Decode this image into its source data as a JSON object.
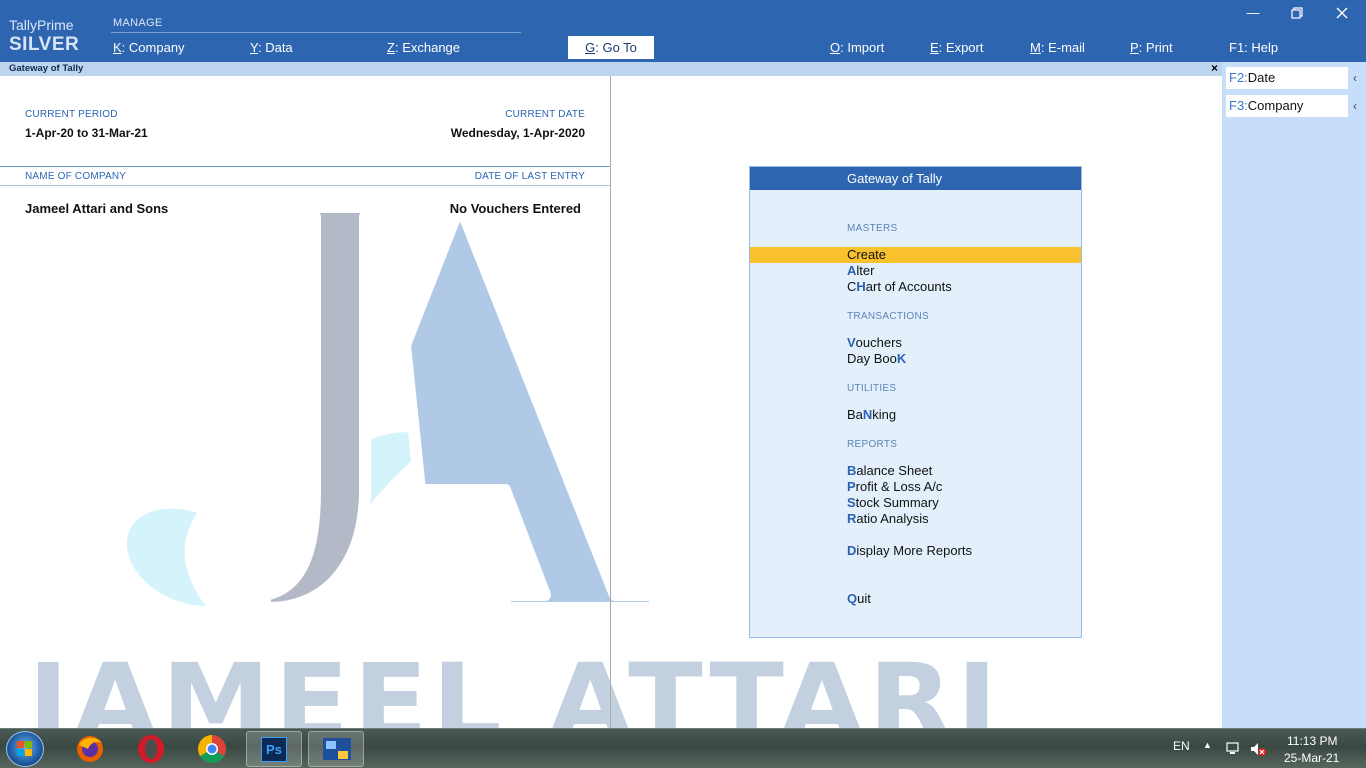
{
  "brand": {
    "product": "TallyPrime",
    "edition": "SILVER"
  },
  "menu": {
    "manage_label": "MANAGE",
    "company": {
      "key": "K",
      "label": "Company"
    },
    "data": {
      "key": "Y",
      "label": "Data"
    },
    "exchange": {
      "key": "Z",
      "label": "Exchange"
    },
    "goto": {
      "key": "G",
      "label": "Go To"
    },
    "import": {
      "key": "O",
      "label": "Import"
    },
    "export": {
      "key": "E",
      "label": "Export"
    },
    "email": {
      "key": "M",
      "label": "E-mail"
    },
    "print": {
      "key": "P",
      "label": "Print"
    },
    "help": {
      "key": "F1",
      "label": "Help"
    }
  },
  "subbar": {
    "title": "Gateway of Tally",
    "close": "×"
  },
  "right_panel": [
    {
      "key": "F2:",
      "label": "Date"
    },
    {
      "key": "F3:",
      "label": "Company"
    }
  ],
  "info": {
    "current_period_label": "CURRENT PERIOD",
    "current_period": "1-Apr-20 to 31-Mar-21",
    "current_date_label": "CURRENT DATE",
    "current_date": "Wednesday, 1-Apr-2020",
    "name_of_company_label": "NAME OF COMPANY",
    "date_of_last_entry_label": "DATE OF LAST ENTRY",
    "company_name": "Jameel Attari and Sons",
    "last_entry": "No Vouchers Entered"
  },
  "watermark": {
    "text": "JAMEEL ATTARI",
    "monogram": "JA"
  },
  "gateway": {
    "title": "Gateway of Tally",
    "sections": {
      "masters": "MASTERS",
      "transactions": "TRANSACTIONS",
      "utilities": "UTILITIES",
      "reports": "REPORTS"
    },
    "items": {
      "create": "Create",
      "alter": "Alter",
      "chart_of_accounts": "CHart of Accounts",
      "vouchers": "Vouchers",
      "day_book": "Day BooK",
      "banking": "BaNking",
      "balance_sheet": "Balance Sheet",
      "profit_loss": "Profit & Loss A/c",
      "stock_summary": "Stock Summary",
      "ratio_analysis": "Ratio Analysis",
      "display_more_reports": "Display More Reports",
      "quit": "Quit"
    }
  },
  "taskbar": {
    "lang": "EN",
    "time": "11:13 PM",
    "date": "25-Mar-21",
    "apps": [
      "firefox-icon",
      "opera-icon",
      "chrome-icon",
      "photoshop-icon",
      "tally-icon"
    ],
    "photoshop_text": "Ps"
  },
  "colors": {
    "topbar": "#2d65b0",
    "selection": "#f9c12e",
    "gateway_bg": "#e3f0fb",
    "right_panel": "#c7defa"
  }
}
